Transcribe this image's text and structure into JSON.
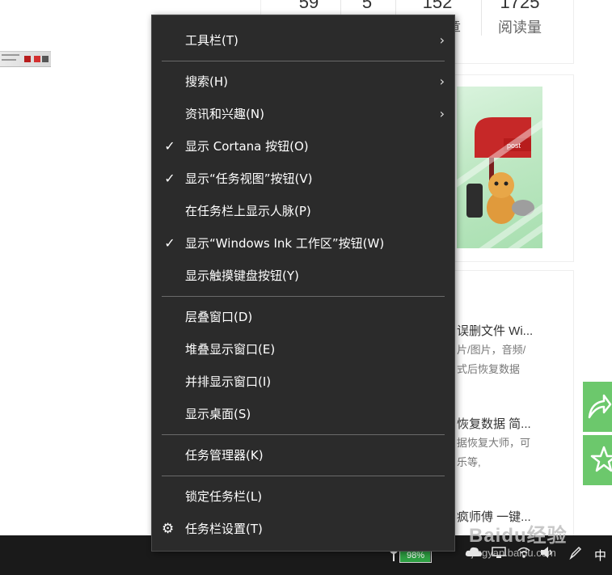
{
  "background": {
    "stats": [
      {
        "value": "59",
        "label": ""
      },
      {
        "value": "5",
        "label": ""
      },
      {
        "value": "152",
        "label": "章"
      },
      {
        "value": "1725",
        "label": "阅读量"
      }
    ],
    "articles": [
      {
        "title": "误删文件 Wi...",
        "desc1": "片/图片，音频/",
        "desc2": "式后恢复数据"
      },
      {
        "title": "恢复数据 简...",
        "desc1": "据恢复大师，可",
        "desc2": "乐等,"
      },
      {
        "title": "疯师傅 一键..."
      }
    ],
    "banner_text": "post",
    "watermark": "Baidu经验",
    "watermark_sub": "jingyan.baidu.com"
  },
  "context_menu": {
    "groups": [
      [
        {
          "label": "工具栏(T)",
          "checked": false,
          "submenu": true
        }
      ],
      [
        {
          "label": "搜索(H)",
          "checked": false,
          "submenu": true
        },
        {
          "label": "资讯和兴趣(N)",
          "checked": false,
          "submenu": true
        },
        {
          "label": "显示 Cortana 按钮(O)",
          "checked": true,
          "submenu": false
        },
        {
          "label": "显示“任务视图”按钮(V)",
          "checked": true,
          "submenu": false
        },
        {
          "label": "在任务栏上显示人脉(P)",
          "checked": false,
          "submenu": false
        },
        {
          "label": "显示“Windows Ink 工作区”按钮(W)",
          "checked": true,
          "submenu": false
        },
        {
          "label": "显示触摸键盘按钮(Y)",
          "checked": false,
          "submenu": false
        }
      ],
      [
        {
          "label": "层叠窗口(D)",
          "checked": false,
          "submenu": false
        },
        {
          "label": "堆叠显示窗口(E)",
          "checked": false,
          "submenu": false
        },
        {
          "label": "并排显示窗口(I)",
          "checked": false,
          "submenu": false
        },
        {
          "label": "显示桌面(S)",
          "checked": false,
          "submenu": false
        }
      ],
      [
        {
          "label": "任务管理器(K)",
          "checked": false,
          "submenu": false
        }
      ],
      [
        {
          "label": "锁定任务栏(L)",
          "checked": false,
          "submenu": false
        },
        {
          "label": "任务栏设置(T)",
          "checked": false,
          "submenu": false,
          "icon": "gear-icon"
        }
      ]
    ]
  },
  "taskbar": {
    "battery": {
      "percent_text": "98%",
      "level": 0.98
    },
    "input_method": "中"
  },
  "colors": {
    "menu_bg": "#2b2b2b",
    "menu_text": "#ffffff",
    "separator": "#6a6a6a",
    "taskbar_bg": "#1a1a1a",
    "share_green": "#6cc86c",
    "battery_green": "#2ea043"
  },
  "glyphs": {
    "check": "✓",
    "arrow": "›",
    "gear": "⚙"
  }
}
